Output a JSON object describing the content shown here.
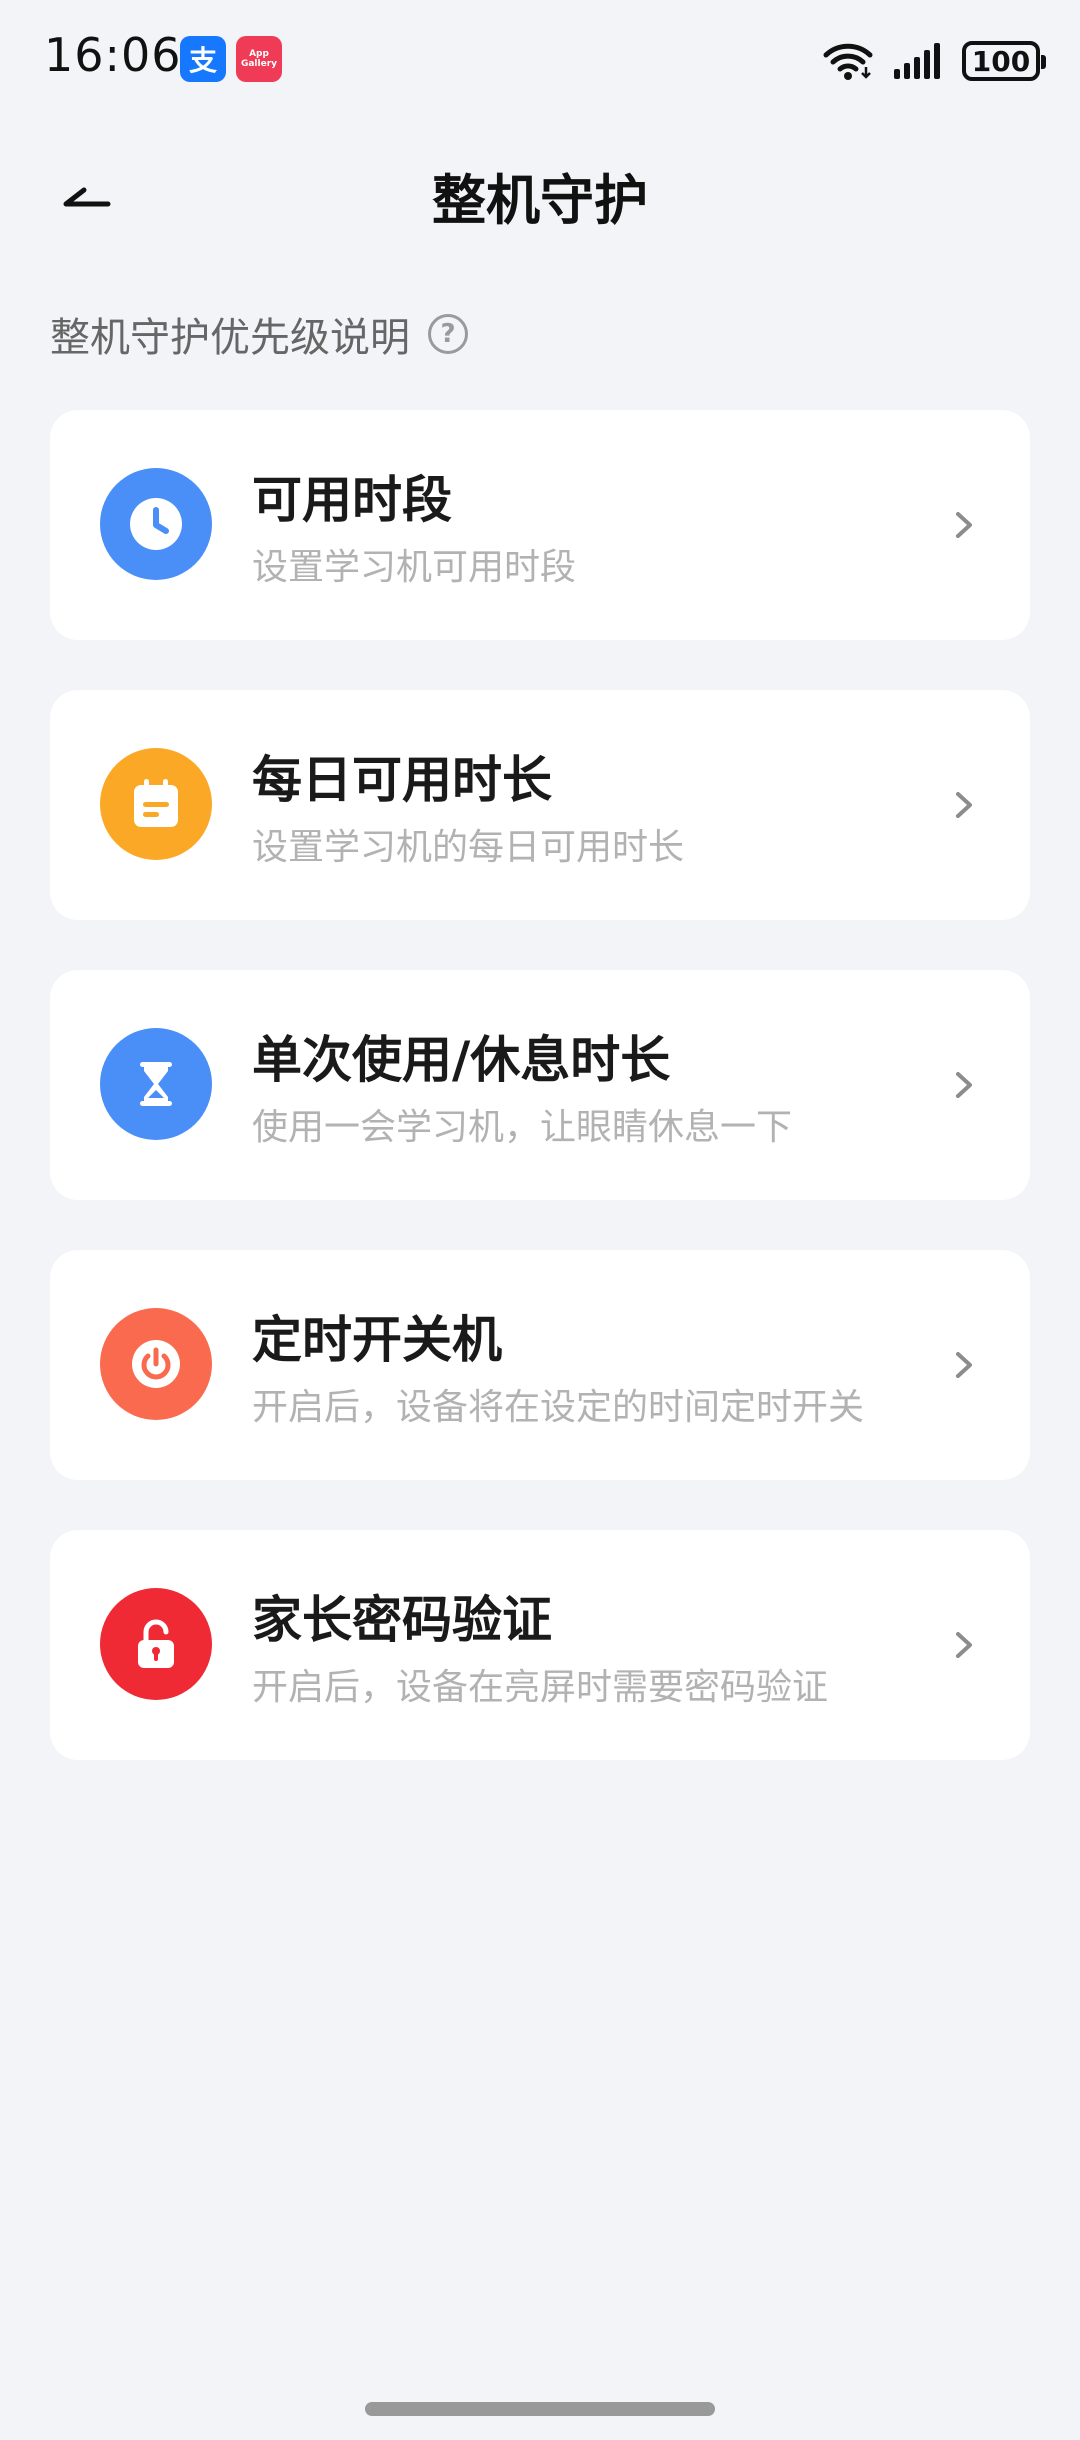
{
  "status_bar": {
    "time": "16:06",
    "alipay_icon_glyph": "支",
    "appgallery_label": "App Gallery",
    "battery": "100"
  },
  "header": {
    "title": "整机守护"
  },
  "priority_link": {
    "label": "整机守护优先级说明",
    "help_glyph": "?"
  },
  "cards": [
    {
      "title": "可用时段",
      "subtitle": "设置学习机可用时段",
      "icon": "clock-icon",
      "color": "#4a8ef7"
    },
    {
      "title": "每日可用时长",
      "subtitle": "设置学习机的每日可用时长",
      "icon": "calendar-icon",
      "color": "#fba826"
    },
    {
      "title": "单次使用/休息时长",
      "subtitle": "使用一会学习机，让眼睛休息一下",
      "icon": "hourglass-icon",
      "color": "#4a8ef7"
    },
    {
      "title": "定时开关机",
      "subtitle": "开启后，设备将在设定的时间定时开关",
      "icon": "power-icon",
      "color": "#fa6a4e"
    },
    {
      "title": "家长密码验证",
      "subtitle": "开启后，设备在亮屏时需要密码验证",
      "icon": "unlock-icon",
      "color": "#f02a35"
    }
  ]
}
